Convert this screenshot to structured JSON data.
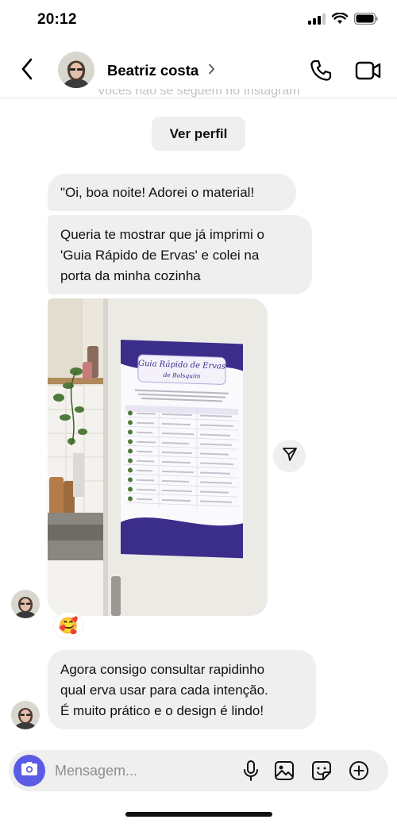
{
  "status_bar": {
    "time": "20:12",
    "icons": [
      "signal-icon",
      "wifi-icon",
      "battery-icon"
    ]
  },
  "header": {
    "contact_name": "Beatriz costa",
    "icons": [
      "back-arrow-icon",
      "chevron-right-icon",
      "phone-icon",
      "video-camera-icon"
    ]
  },
  "notice": {
    "text": "Vocês não se seguem no Instagram"
  },
  "view_profile_label": "Ver perfil",
  "messages": [
    {
      "lines": [
        "\"Oi, boa noite! Adorei o material!"
      ]
    },
    {
      "lines": [
        "Queria te mostrar que já imprimi o",
        "'Guia Rápido de Ervas' e colei na",
        "porta da minha cozinha"
      ]
    },
    {
      "lines": [
        "Agora consigo consultar rapidinho",
        "qual erva usar para cada intenção.",
        "É muito prático e o design é lindo!"
      ]
    }
  ],
  "photo": {
    "poster_title_line1": "Guia Rápido de Ervas",
    "poster_title_line2": "de Bolsquim"
  },
  "reaction_emoji": "🥰",
  "composer": {
    "placeholder": "Mensagem...",
    "icons": [
      "camera-icon",
      "microphone-icon",
      "gallery-icon",
      "sticker-icon",
      "add-icon"
    ]
  },
  "colors": {
    "bubble": "#efefef",
    "camera_button": "#5b5be6",
    "poster_accent": "#3b2d8a"
  }
}
